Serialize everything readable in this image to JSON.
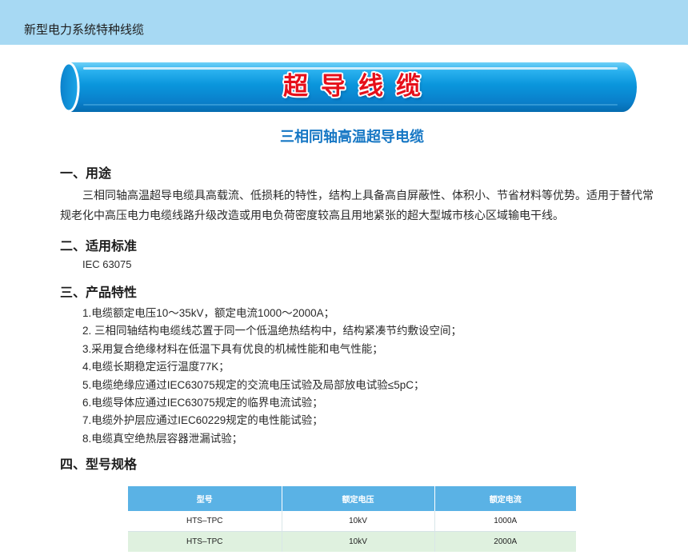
{
  "header": {
    "title": "新型电力系统特种线缆"
  },
  "banner": {
    "title": "超导线缆"
  },
  "product": {
    "name": "三相同轴高温超导电缆"
  },
  "sections": {
    "usage": {
      "heading": "一、用途",
      "text": "三相同轴高温超导电缆具高载流、低损耗的特性，结构上具备高自屏蔽性、体积小、节省材料等优势。适用于替代常规老化中高压电力电缆线路升级改造或用电负荷密度较高且用地紧张的超大型城市核心区域输电干线。"
    },
    "standard": {
      "heading": "二、适用标准",
      "text": "IEC 63075"
    },
    "features": {
      "heading": "三、产品特性",
      "items": [
        "1.电缆额定电压10～35kV，额定电流1000～2000A；",
        "2. 三相同轴结构电缆线芯置于同一个低温绝热结构中，结构紧凑节约敷设空间；",
        "3.采用复合绝缘材料在低温下具有优良的机械性能和电气性能；",
        "4.电缆长期稳定运行温度77K；",
        "5.电缆绝缘应通过IEC63075规定的交流电压试验及局部放电试验≤5pC；",
        "6.电缆导体应通过IEC63075规定的临界电流试验；",
        "7.电缆外护层应通过IEC60229规定的电性能试验；",
        "8.电缆真空绝热层容器泄漏试验；"
      ]
    },
    "specs": {
      "heading": "四、型号规格",
      "columns": [
        "型号",
        "额定电压",
        "额定电流"
      ],
      "rows": [
        [
          "HTS–TPC",
          "10kV",
          "1000A"
        ],
        [
          "HTS–TPC",
          "10kV",
          "2000A"
        ]
      ]
    }
  },
  "colors": {
    "header_band": "#a7d9f3",
    "banner_blue": "#0a96dc",
    "banner_title_red": "#e60f1a",
    "product_name_blue": "#1677c4",
    "table_header": "#5ab2e5",
    "table_row_alt": "#dff1df"
  }
}
